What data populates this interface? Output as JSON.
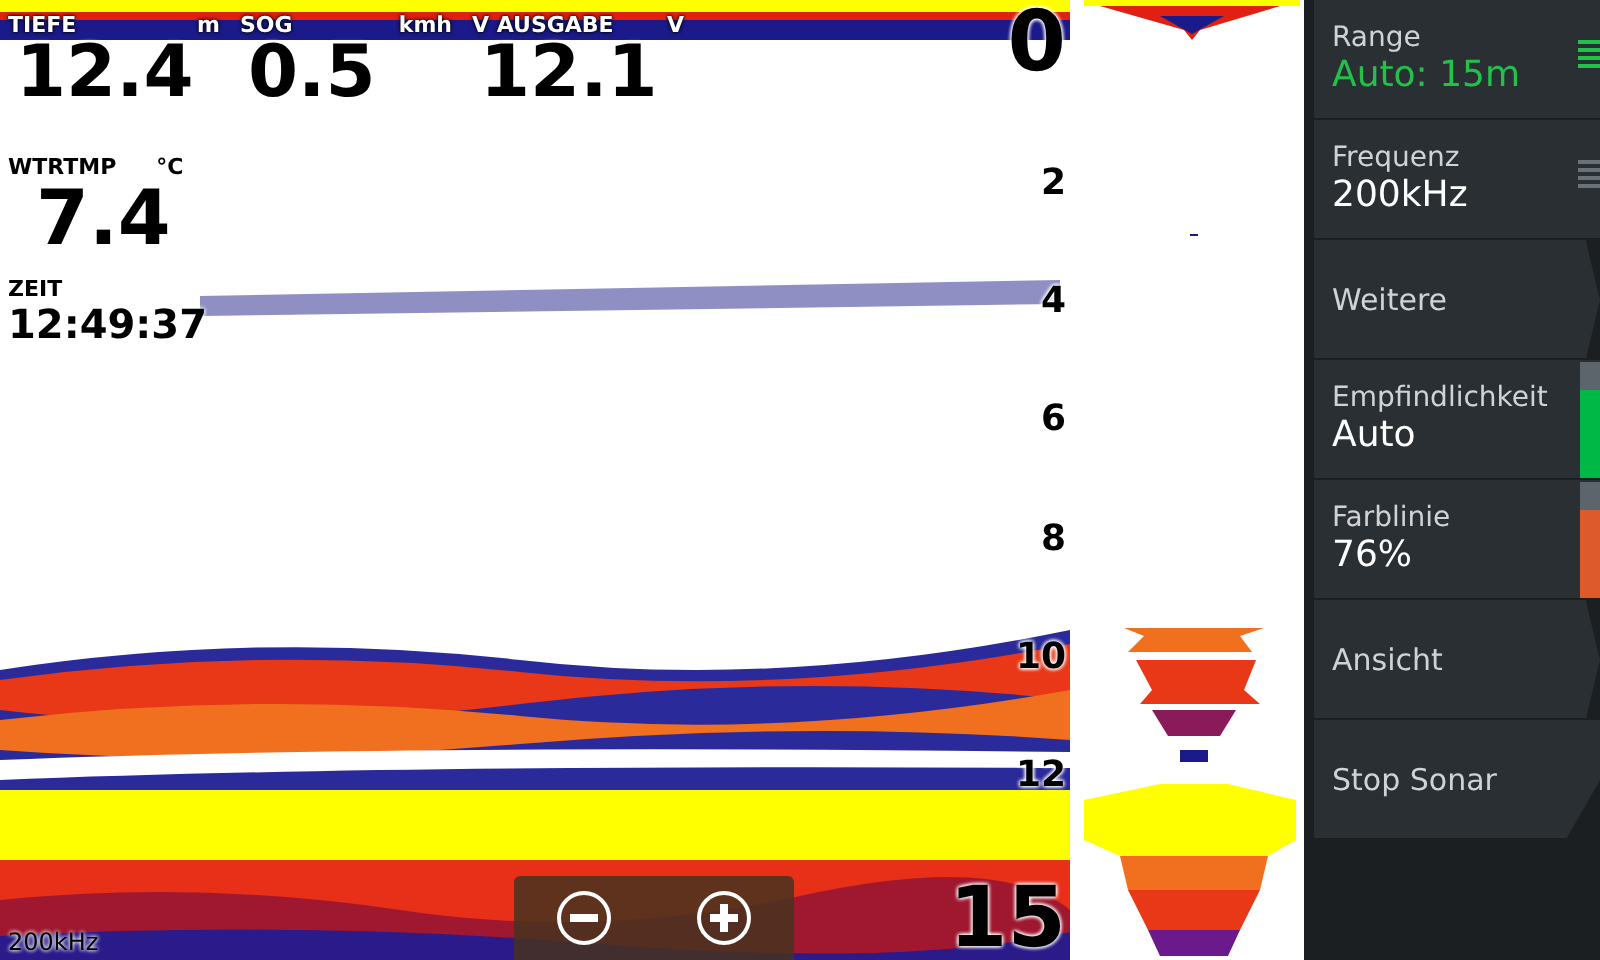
{
  "data_fields": [
    {
      "label": "TIEFE",
      "unit": "m",
      "value": "12.4"
    },
    {
      "label": "SOG",
      "unit": "kmh",
      "value": "0.5"
    },
    {
      "label": "V AUSGABE",
      "unit": "V",
      "value": "12.1"
    },
    {
      "label": "WTRTMP",
      "unit": "°C",
      "value": "7.4"
    },
    {
      "label": "ZEIT",
      "value": "12:49:37"
    }
  ],
  "depth_scale": [
    "0",
    "2",
    "4",
    "6",
    "8",
    "10",
    "12",
    "15"
  ],
  "frequency_label": "200kHz",
  "zoom_buttons": [
    {
      "kind": "zoom-out"
    },
    {
      "kind": "zoom-in"
    }
  ],
  "menu": [
    {
      "kind": "value",
      "label": "Range",
      "value": "Auto: 15m",
      "highlighted": true,
      "indicator": {
        "kind": "lines",
        "active": true
      }
    },
    {
      "kind": "value",
      "label": "Frequenz",
      "value": "200kHz",
      "highlighted": false,
      "indicator": {
        "kind": "lines",
        "active": false
      }
    },
    {
      "kind": "submenu",
      "label": "Weitere"
    },
    {
      "kind": "value",
      "label": "Empfindlichkeit",
      "value": "Auto",
      "highlighted": false,
      "indicator": {
        "kind": "bar",
        "level": 0.76,
        "color": "#00b845"
      }
    },
    {
      "kind": "value",
      "label": "Farblinie",
      "value": "76%",
      "highlighted": false,
      "indicator": {
        "kind": "bar",
        "level": 0.76,
        "color": "#dd5a2c"
      }
    },
    {
      "kind": "submenu",
      "label": "Ansicht"
    },
    {
      "kind": "action",
      "label": "Stop Sonar"
    }
  ]
}
